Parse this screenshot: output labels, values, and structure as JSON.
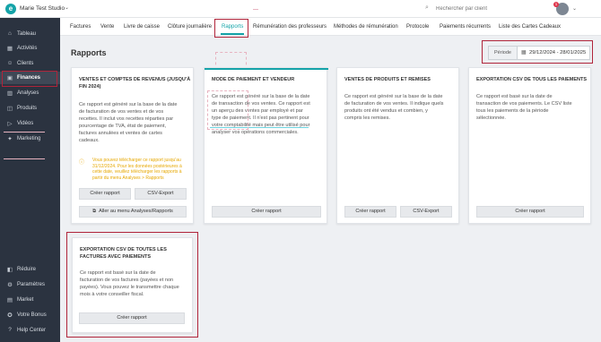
{
  "topbar": {
    "logo_letter": "e",
    "studio": "Marie Test Studio",
    "search_placeholder": "Rechercher par client",
    "notif_count": "1"
  },
  "sidebar": {
    "items": [
      {
        "label": "Tableau",
        "icon": "home-icon",
        "glyph": "⌂"
      },
      {
        "label": "Activités",
        "icon": "calendar-icon",
        "glyph": "▦"
      },
      {
        "label": "Clients",
        "icon": "user-icon",
        "glyph": "☺"
      },
      {
        "label": "Finances",
        "icon": "wallet-icon",
        "glyph": "▣"
      },
      {
        "label": "Analyses",
        "icon": "chart-icon",
        "glyph": "▥"
      },
      {
        "label": "Produits",
        "icon": "box-icon",
        "glyph": "◫"
      },
      {
        "label": "Vidéos",
        "icon": "video-icon",
        "glyph": "▷"
      },
      {
        "label": "Marketing",
        "icon": "megaphone-icon",
        "glyph": "✦"
      }
    ],
    "bottom_items": [
      {
        "label": "Réduire",
        "icon": "collapse-icon",
        "glyph": "◧"
      },
      {
        "label": "Paramètres",
        "icon": "gear-icon",
        "glyph": "⚙"
      },
      {
        "label": "Market",
        "icon": "store-icon",
        "glyph": "▤"
      },
      {
        "label": "Votre Bonus",
        "icon": "gift-icon",
        "glyph": "✪"
      },
      {
        "label": "Help Center",
        "icon": "help-icon",
        "glyph": "?"
      }
    ]
  },
  "tabs": [
    {
      "label": "Factures"
    },
    {
      "label": "Vente"
    },
    {
      "label": "Livre de caisse"
    },
    {
      "label": "Clôture journalière"
    },
    {
      "label": "Rapports"
    },
    {
      "label": "Rémunération des professeurs"
    },
    {
      "label": "Méthodes de rémunération"
    },
    {
      "label": "Protocole"
    },
    {
      "label": "Paiements récurrents"
    },
    {
      "label": "Liste des Cartes Cadeaux"
    }
  ],
  "page": {
    "title": "Rapports",
    "periode_label": "Période",
    "periode_value": "29/12/2024 - 28/01/2025"
  },
  "cards": [
    {
      "title_l1": "VENTES ET COMPTES DE REVENUS (JUSQU'À",
      "title_l2": "FIN 2024)",
      "desc": [
        "Ce rapport est généré sur la base de la date",
        "de facturation de vos ventes et de vos",
        "recettes. Il inclut vos recettes réparties par",
        "pourcentage de TVA, état de paiement,",
        "factures annulées et ventes de cartes",
        "cadeaux."
      ],
      "warning": [
        "Vous pouvez télécharger ce rapport jusqu'au",
        "31/12/2024. Pour les données postérieures à",
        "cette date, veuillez télécharger les rapports à",
        "partir du menu Analyses > Rapports"
      ],
      "btn1": "Créer rapport",
      "btn2": "CSV-Export",
      "btn3": "Aller au menu Analyses/Rapports"
    },
    {
      "title_l1": "MODE DE PAIEMENT ET VENDEUR",
      "desc": [
        "Ce rapport est généré sur la base de la date",
        "de transaction de vos ventes. Ce rapport est",
        "un aperçu des ventes par employé et par",
        "type de paiement. Il n'est pas pertinent pour",
        "votre comptabilité mais peut être utilisé pour",
        "analyser vos opérations commerciales."
      ],
      "btn1": "Créer rapport"
    },
    {
      "title_l1": "VENTES DE PRODUITS ET REMISES",
      "desc": [
        "Ce rapport est généré sur la base de la date",
        "de facturation de vos ventes. Il indique quels",
        "produits ont été vendus et combien, y",
        "compris les remises."
      ],
      "btn1": "Créer rapport",
      "btn2": "CSV-Export"
    },
    {
      "title_l1": "EXPORTATION CSV DE TOUS LES PAIEMENTS",
      "desc": [
        "Ce rapport est basé sur la date de",
        "transaction de vos paiements. Le CSV liste",
        "tous les paiements de la période",
        "sélectionnée."
      ],
      "btn1": "Créer rapport"
    },
    {
      "title_l1": "EXPORTATION CSV DE TOUTES LES",
      "title_l2": "FACTURES AVEC PAIEMENTS",
      "desc": [
        "Ce rapport est basé sur la date de",
        "facturation de vos factures (payées et non",
        "payées). Vous pouvez le transmettre chaque",
        "mois à votre conseiller fiscal."
      ],
      "btn1": "Créer rapport"
    }
  ]
}
